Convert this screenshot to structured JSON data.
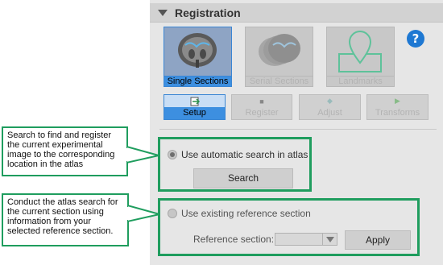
{
  "panel": {
    "title": "Registration"
  },
  "modes": [
    {
      "label": "Single Sections",
      "selected": true
    },
    {
      "label": "Serial Sections",
      "selected": false
    },
    {
      "label": "Landmarks",
      "selected": false
    }
  ],
  "help": {
    "label": "?"
  },
  "steps": [
    {
      "label": "Setup",
      "selected": true
    },
    {
      "label": "Register",
      "selected": false
    },
    {
      "label": "Adjust",
      "selected": false
    },
    {
      "label": "Transforms",
      "selected": false
    }
  ],
  "auto_search": {
    "label": "Use automatic search in atlas",
    "button": "Search",
    "selected": true
  },
  "existing_ref": {
    "label": "Use existing reference section",
    "field_label": "Reference section:",
    "value": "",
    "button": "Apply",
    "selected": false
  },
  "callouts": {
    "c1": "Search to find and register the current experimental image to the corresponding location in the atlas",
    "c2": "Conduct the atlas search for the current section using information from your selected reference section."
  },
  "colors": {
    "highlight": "#1f9d5e",
    "selection": "#3d8fe0",
    "help": "#1e78d2"
  }
}
